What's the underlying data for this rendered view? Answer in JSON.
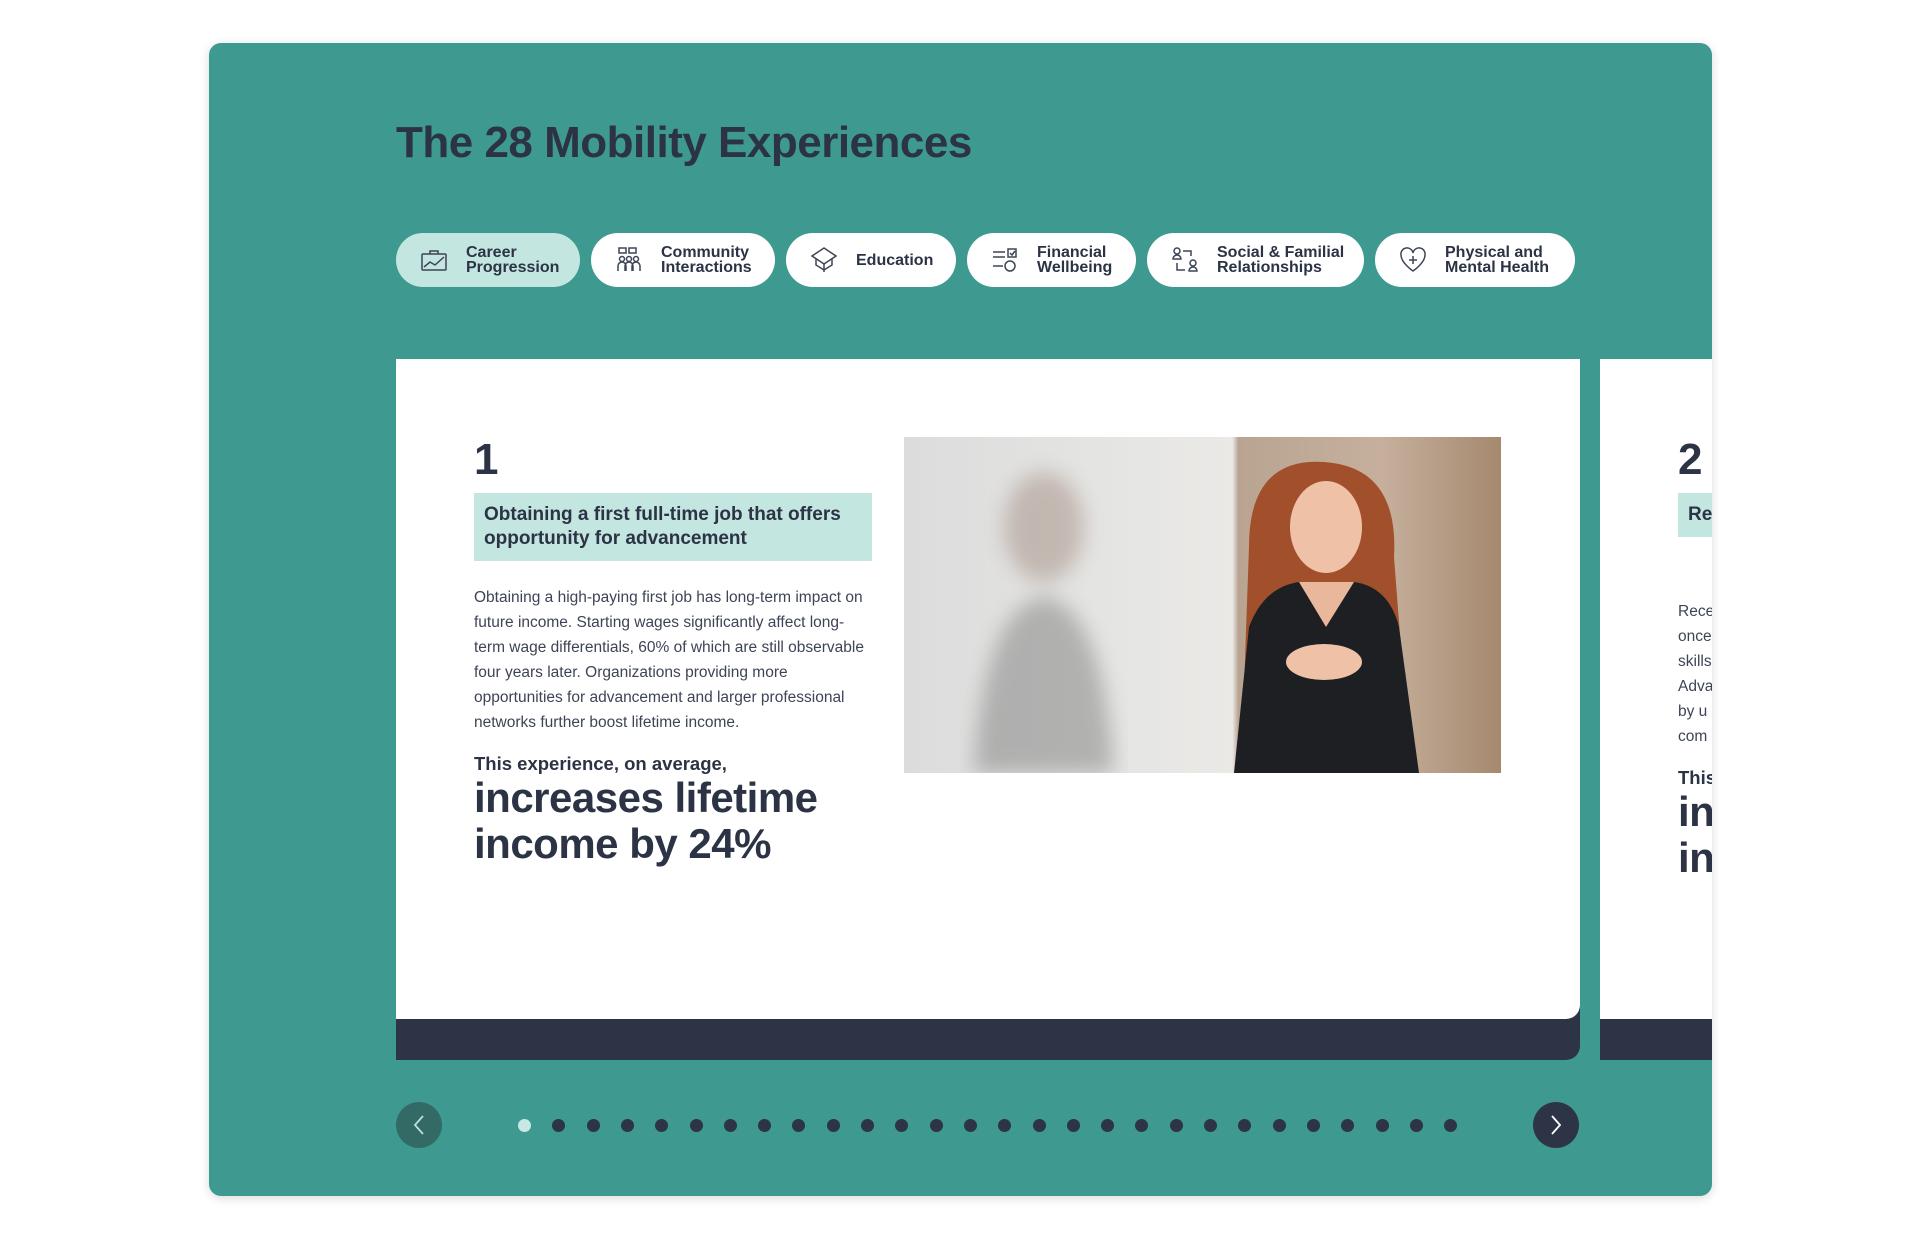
{
  "title": "The 28 Mobility Experiences",
  "colors": {
    "panel": "#3e9a90",
    "dark": "#2d3446",
    "highlight": "#c3e6e1"
  },
  "tabs": [
    {
      "label": "Career\nProgression",
      "icon": "briefcase-chart-icon",
      "active": true
    },
    {
      "label": "Community\nInteractions",
      "icon": "people-chat-icon",
      "active": false
    },
    {
      "label": "Education",
      "icon": "graduation-cap-icon",
      "active": false
    },
    {
      "label": "Financial\nWellbeing",
      "icon": "checklist-dollar-icon",
      "active": false
    },
    {
      "label": "Social & Familial\nRelationships",
      "icon": "people-connect-icon",
      "active": false
    },
    {
      "label": "Physical and\nMental Health",
      "icon": "heart-plus-icon",
      "active": false
    }
  ],
  "cards": [
    {
      "number": "1",
      "heading": "Obtaining a first full-time job that offers opportunity for advancement",
      "body": "Obtaining a high-paying first job has long-term impact on future income. Starting wages significantly affect long-term wage differentials, 60% of which are still observable four years later. Organizations providing more opportunities for advancement and larger professional networks further boost lifetime income.",
      "lead": "This experience, on average,",
      "impact": "increases lifetime income by 24%"
    },
    {
      "number": "2",
      "heading": "Re",
      "body": "Rece\nonce\nskills\nAdva\nby u\ncom",
      "lead": "This",
      "impact": "in\nin"
    }
  ],
  "pagination": {
    "total": 28,
    "current": 1,
    "prev_icon": "chevron-left-icon",
    "next_icon": "chevron-right-icon"
  }
}
